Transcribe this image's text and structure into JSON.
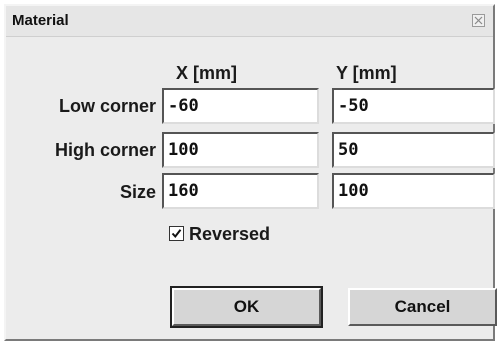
{
  "window": {
    "title": "Material"
  },
  "columns": {
    "x_header": "X [mm]",
    "y_header": "Y [mm]"
  },
  "rows": [
    {
      "label": "Low corner",
      "x_value": "-60",
      "y_value": "-50"
    },
    {
      "label": "High corner",
      "x_value": "100",
      "y_value": "50"
    },
    {
      "label": "Size",
      "x_value": "160",
      "y_value": "100"
    }
  ],
  "options": {
    "reversed_label": "Reversed",
    "reversed_checked": true
  },
  "buttons": {
    "ok_label": "OK",
    "cancel_label": "Cancel"
  },
  "icons": {
    "close": "close-icon",
    "check": "checkmark-icon"
  }
}
